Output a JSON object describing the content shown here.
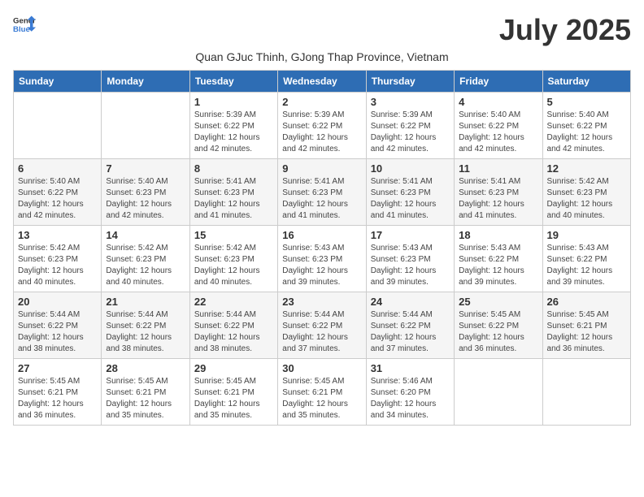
{
  "logo": {
    "text_general": "General",
    "text_blue": "Blue"
  },
  "title": "July 2025",
  "subtitle": "Quan GJuc Thinh, GJong Thap Province, Vietnam",
  "weekdays": [
    "Sunday",
    "Monday",
    "Tuesday",
    "Wednesday",
    "Thursday",
    "Friday",
    "Saturday"
  ],
  "weeks": [
    [
      {
        "day": "",
        "info": ""
      },
      {
        "day": "",
        "info": ""
      },
      {
        "day": "1",
        "info": "Sunrise: 5:39 AM\nSunset: 6:22 PM\nDaylight: 12 hours and 42 minutes."
      },
      {
        "day": "2",
        "info": "Sunrise: 5:39 AM\nSunset: 6:22 PM\nDaylight: 12 hours and 42 minutes."
      },
      {
        "day": "3",
        "info": "Sunrise: 5:39 AM\nSunset: 6:22 PM\nDaylight: 12 hours and 42 minutes."
      },
      {
        "day": "4",
        "info": "Sunrise: 5:40 AM\nSunset: 6:22 PM\nDaylight: 12 hours and 42 minutes."
      },
      {
        "day": "5",
        "info": "Sunrise: 5:40 AM\nSunset: 6:22 PM\nDaylight: 12 hours and 42 minutes."
      }
    ],
    [
      {
        "day": "6",
        "info": "Sunrise: 5:40 AM\nSunset: 6:22 PM\nDaylight: 12 hours and 42 minutes."
      },
      {
        "day": "7",
        "info": "Sunrise: 5:40 AM\nSunset: 6:23 PM\nDaylight: 12 hours and 42 minutes."
      },
      {
        "day": "8",
        "info": "Sunrise: 5:41 AM\nSunset: 6:23 PM\nDaylight: 12 hours and 41 minutes."
      },
      {
        "day": "9",
        "info": "Sunrise: 5:41 AM\nSunset: 6:23 PM\nDaylight: 12 hours and 41 minutes."
      },
      {
        "day": "10",
        "info": "Sunrise: 5:41 AM\nSunset: 6:23 PM\nDaylight: 12 hours and 41 minutes."
      },
      {
        "day": "11",
        "info": "Sunrise: 5:41 AM\nSunset: 6:23 PM\nDaylight: 12 hours and 41 minutes."
      },
      {
        "day": "12",
        "info": "Sunrise: 5:42 AM\nSunset: 6:23 PM\nDaylight: 12 hours and 40 minutes."
      }
    ],
    [
      {
        "day": "13",
        "info": "Sunrise: 5:42 AM\nSunset: 6:23 PM\nDaylight: 12 hours and 40 minutes."
      },
      {
        "day": "14",
        "info": "Sunrise: 5:42 AM\nSunset: 6:23 PM\nDaylight: 12 hours and 40 minutes."
      },
      {
        "day": "15",
        "info": "Sunrise: 5:42 AM\nSunset: 6:23 PM\nDaylight: 12 hours and 40 minutes."
      },
      {
        "day": "16",
        "info": "Sunrise: 5:43 AM\nSunset: 6:23 PM\nDaylight: 12 hours and 39 minutes."
      },
      {
        "day": "17",
        "info": "Sunrise: 5:43 AM\nSunset: 6:23 PM\nDaylight: 12 hours and 39 minutes."
      },
      {
        "day": "18",
        "info": "Sunrise: 5:43 AM\nSunset: 6:22 PM\nDaylight: 12 hours and 39 minutes."
      },
      {
        "day": "19",
        "info": "Sunrise: 5:43 AM\nSunset: 6:22 PM\nDaylight: 12 hours and 39 minutes."
      }
    ],
    [
      {
        "day": "20",
        "info": "Sunrise: 5:44 AM\nSunset: 6:22 PM\nDaylight: 12 hours and 38 minutes."
      },
      {
        "day": "21",
        "info": "Sunrise: 5:44 AM\nSunset: 6:22 PM\nDaylight: 12 hours and 38 minutes."
      },
      {
        "day": "22",
        "info": "Sunrise: 5:44 AM\nSunset: 6:22 PM\nDaylight: 12 hours and 38 minutes."
      },
      {
        "day": "23",
        "info": "Sunrise: 5:44 AM\nSunset: 6:22 PM\nDaylight: 12 hours and 37 minutes."
      },
      {
        "day": "24",
        "info": "Sunrise: 5:44 AM\nSunset: 6:22 PM\nDaylight: 12 hours and 37 minutes."
      },
      {
        "day": "25",
        "info": "Sunrise: 5:45 AM\nSunset: 6:22 PM\nDaylight: 12 hours and 36 minutes."
      },
      {
        "day": "26",
        "info": "Sunrise: 5:45 AM\nSunset: 6:21 PM\nDaylight: 12 hours and 36 minutes."
      }
    ],
    [
      {
        "day": "27",
        "info": "Sunrise: 5:45 AM\nSunset: 6:21 PM\nDaylight: 12 hours and 36 minutes."
      },
      {
        "day": "28",
        "info": "Sunrise: 5:45 AM\nSunset: 6:21 PM\nDaylight: 12 hours and 35 minutes."
      },
      {
        "day": "29",
        "info": "Sunrise: 5:45 AM\nSunset: 6:21 PM\nDaylight: 12 hours and 35 minutes."
      },
      {
        "day": "30",
        "info": "Sunrise: 5:45 AM\nSunset: 6:21 PM\nDaylight: 12 hours and 35 minutes."
      },
      {
        "day": "31",
        "info": "Sunrise: 5:46 AM\nSunset: 6:20 PM\nDaylight: 12 hours and 34 minutes."
      },
      {
        "day": "",
        "info": ""
      },
      {
        "day": "",
        "info": ""
      }
    ]
  ]
}
